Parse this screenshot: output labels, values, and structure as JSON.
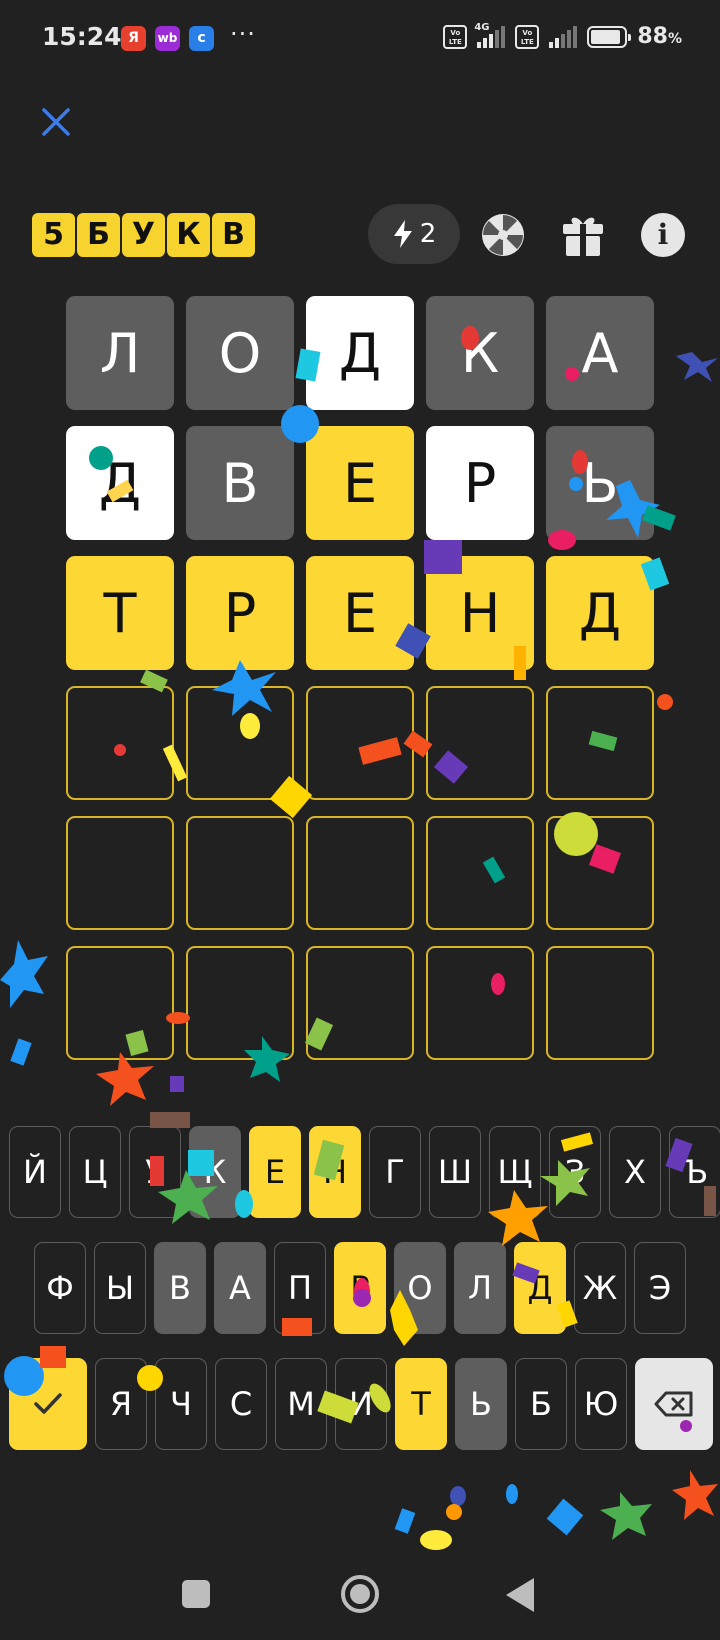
{
  "status_bar": {
    "time": "15:24",
    "apps": [
      {
        "label": "Я",
        "color": "#e8402f"
      },
      {
        "label": "wb",
        "color": "#9b2cd6"
      },
      {
        "label": "c",
        "color": "#2a7ee8"
      }
    ],
    "more": "···",
    "network": "4G",
    "volte1": "Vo LTE",
    "volte2": "Vo LTE",
    "battery_percent": "88",
    "battery_unit": "%",
    "battery_level": 0.88
  },
  "header": {
    "close_icon": "close-icon",
    "logo_letters": [
      "5",
      "Б",
      "У",
      "К",
      "В"
    ],
    "hints_count": "2",
    "hints_icon": "lightning-icon",
    "wheel_icon": "wheel-icon",
    "gift_icon": "gift-icon",
    "info_label": "i"
  },
  "board": {
    "rows": [
      [
        {
          "l": "Л",
          "s": "absent"
        },
        {
          "l": "О",
          "s": "absent"
        },
        {
          "l": "Д",
          "s": "present"
        },
        {
          "l": "К",
          "s": "absent"
        },
        {
          "l": "А",
          "s": "absent"
        }
      ],
      [
        {
          "l": "Д",
          "s": "present"
        },
        {
          "l": "В",
          "s": "absent"
        },
        {
          "l": "Е",
          "s": "correct"
        },
        {
          "l": "Р",
          "s": "present"
        },
        {
          "l": "Ь",
          "s": "absent"
        }
      ],
      [
        {
          "l": "Т",
          "s": "correct"
        },
        {
          "l": "Р",
          "s": "correct"
        },
        {
          "l": "Е",
          "s": "correct"
        },
        {
          "l": "Н",
          "s": "correct"
        },
        {
          "l": "Д",
          "s": "correct"
        }
      ],
      [
        {
          "l": "",
          "s": "empty"
        },
        {
          "l": "",
          "s": "empty"
        },
        {
          "l": "",
          "s": "empty"
        },
        {
          "l": "",
          "s": "empty"
        },
        {
          "l": "",
          "s": "empty"
        }
      ],
      [
        {
          "l": "",
          "s": "empty"
        },
        {
          "l": "",
          "s": "empty"
        },
        {
          "l": "",
          "s": "empty"
        },
        {
          "l": "",
          "s": "empty"
        },
        {
          "l": "",
          "s": "empty"
        }
      ],
      [
        {
          "l": "",
          "s": "empty"
        },
        {
          "l": "",
          "s": "empty"
        },
        {
          "l": "",
          "s": "empty"
        },
        {
          "l": "",
          "s": "empty"
        },
        {
          "l": "",
          "s": "empty"
        }
      ]
    ]
  },
  "keyboard": {
    "row1": [
      {
        "l": "Й",
        "s": "normal"
      },
      {
        "l": "Ц",
        "s": "normal"
      },
      {
        "l": "У",
        "s": "normal"
      },
      {
        "l": "К",
        "s": "absent"
      },
      {
        "l": "Е",
        "s": "correct"
      },
      {
        "l": "Н",
        "s": "correct"
      },
      {
        "l": "Г",
        "s": "normal"
      },
      {
        "l": "Ш",
        "s": "normal"
      },
      {
        "l": "Щ",
        "s": "normal"
      },
      {
        "l": "З",
        "s": "normal"
      },
      {
        "l": "Х",
        "s": "normal"
      },
      {
        "l": "Ъ",
        "s": "normal"
      }
    ],
    "row2": [
      {
        "l": "Ф",
        "s": "normal"
      },
      {
        "l": "Ы",
        "s": "normal"
      },
      {
        "l": "В",
        "s": "absent"
      },
      {
        "l": "А",
        "s": "absent"
      },
      {
        "l": "П",
        "s": "normal"
      },
      {
        "l": "Р",
        "s": "correct"
      },
      {
        "l": "О",
        "s": "absent"
      },
      {
        "l": "Л",
        "s": "absent"
      },
      {
        "l": "Д",
        "s": "correct"
      },
      {
        "l": "Ж",
        "s": "normal"
      },
      {
        "l": "Э",
        "s": "normal"
      }
    ],
    "row3": [
      {
        "l": "Я",
        "s": "normal"
      },
      {
        "l": "Ч",
        "s": "normal"
      },
      {
        "l": "С",
        "s": "normal"
      },
      {
        "l": "М",
        "s": "normal"
      },
      {
        "l": "И",
        "s": "normal"
      },
      {
        "l": "Т",
        "s": "correct"
      },
      {
        "l": "Ь",
        "s": "absent"
      },
      {
        "l": "Б",
        "s": "normal"
      },
      {
        "l": "Ю",
        "s": "normal"
      }
    ],
    "enter_icon": "checkmark-icon",
    "backspace_icon": "backspace-icon"
  },
  "nav_bar": {
    "recents_icon": "recents-icon",
    "home_icon": "home-icon",
    "back_icon": "back-icon"
  },
  "colors": {
    "background": "#212121",
    "correct": "#fdd835",
    "present": "#ffffff",
    "absent": "#5e5e5e",
    "close": "#3d7be8"
  }
}
